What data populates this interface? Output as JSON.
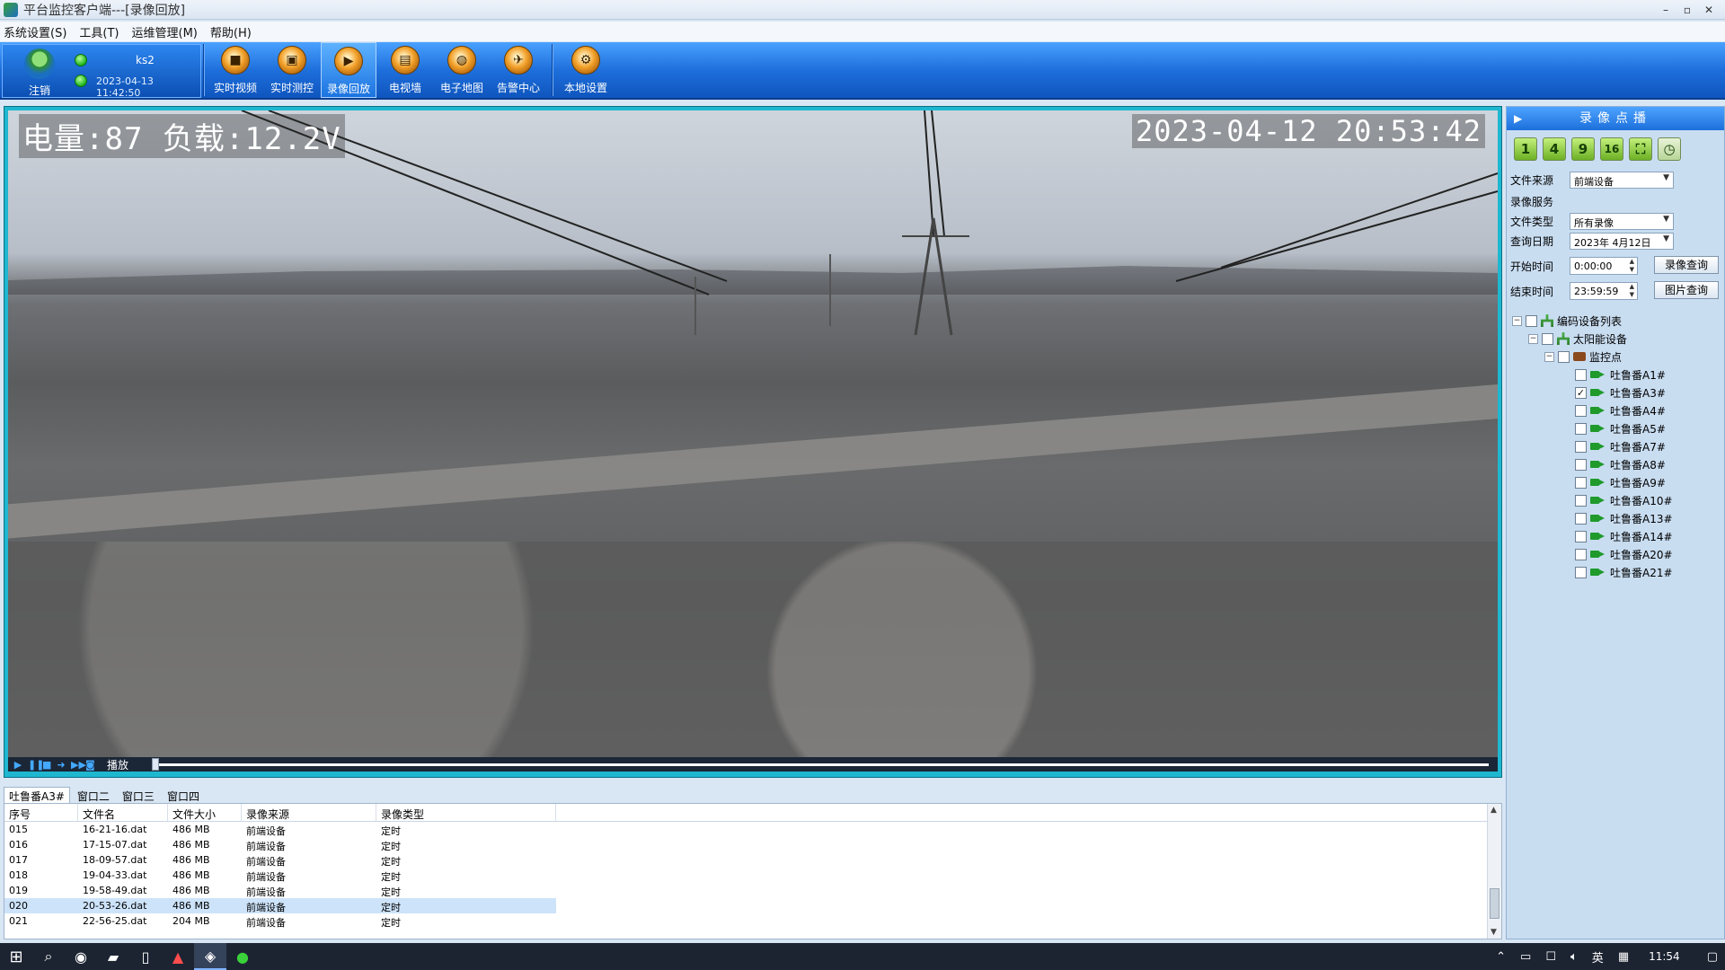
{
  "window": {
    "title": "平台监控客户端---[录像回放]",
    "controls": [
      "–",
      "▫",
      "✕"
    ]
  },
  "menu": [
    "系统设置(S)",
    "工具(T)",
    "运维管理(M)",
    "帮助(H)"
  ],
  "toolbar": {
    "logout_label": "注销",
    "username": "ks2",
    "datetime": "2023-04-13 11:42:50",
    "buttons": [
      {
        "label": "实时视频",
        "icon": "video-camera-icon",
        "active": false
      },
      {
        "label": "实时测控",
        "icon": "control-icon",
        "active": false
      },
      {
        "label": "录像回放",
        "icon": "playback-icon",
        "active": true
      },
      {
        "label": "电视墙",
        "icon": "tv-wall-icon",
        "active": false
      },
      {
        "label": "电子地图",
        "icon": "globe-map-icon",
        "active": false
      },
      {
        "label": "告警中心",
        "icon": "alarm-icon",
        "active": false
      },
      {
        "label": "本地设置",
        "icon": "gear-icon",
        "active": false
      }
    ]
  },
  "video": {
    "osd_left": "电量:87 负载:12.2V",
    "osd_right": "2023-04-12 20:53:42",
    "play_label": "播放",
    "playback_progress": 0.0
  },
  "tabs": [
    "吐鲁番A3#",
    "窗口二",
    "窗口三",
    "窗口四"
  ],
  "file_list": {
    "columns": [
      "序号",
      "文件名",
      "文件大小",
      "录像来源",
      "录像类型"
    ],
    "rows": [
      [
        "015",
        "16-21-16.dat",
        "486 MB",
        "前端设备",
        "定时"
      ],
      [
        "016",
        "17-15-07.dat",
        "486 MB",
        "前端设备",
        "定时"
      ],
      [
        "017",
        "18-09-57.dat",
        "486 MB",
        "前端设备",
        "定时"
      ],
      [
        "018",
        "19-04-33.dat",
        "486 MB",
        "前端设备",
        "定时"
      ],
      [
        "019",
        "19-58-49.dat",
        "486 MB",
        "前端设备",
        "定时"
      ],
      [
        "020",
        "20-53-26.dat",
        "486 MB",
        "前端设备",
        "定时"
      ],
      [
        "021",
        "22-56-25.dat",
        "204 MB",
        "前端设备",
        "定时"
      ]
    ],
    "selected_row": 5
  },
  "right_panel": {
    "title": "录像点播",
    "layout_buttons": [
      "1",
      "4",
      "9",
      "16",
      "⛶",
      "◷"
    ],
    "file_source_label": "文件来源",
    "file_source_value": "前端设备",
    "record_service_label": "录像服务",
    "file_type_label": "文件类型",
    "file_type_value": "所有录像",
    "query_date_label": "查询日期",
    "query_date_value": "2023年  4月12日",
    "start_time_label": "开始时间",
    "start_time_value": "0:00:00",
    "end_time_label": "结束时间",
    "end_time_value": "23:59:59",
    "record_query_button": "录像查询",
    "image_query_button": "图片查询",
    "tree": {
      "root": "编码设备列表",
      "group": "太阳能设备",
      "monitor": "监控点",
      "cameras": [
        {
          "name": "吐鲁番A1#",
          "checked": false
        },
        {
          "name": "吐鲁番A3#",
          "checked": true
        },
        {
          "name": "吐鲁番A4#",
          "checked": false
        },
        {
          "name": "吐鲁番A5#",
          "checked": false
        },
        {
          "name": "吐鲁番A7#",
          "checked": false
        },
        {
          "name": "吐鲁番A8#",
          "checked": false
        },
        {
          "name": "吐鲁番A9#",
          "checked": false
        },
        {
          "name": "吐鲁番A10#",
          "checked": false
        },
        {
          "name": "吐鲁番A13#",
          "checked": false
        },
        {
          "name": "吐鲁番A14#",
          "checked": false
        },
        {
          "name": "吐鲁番A20#",
          "checked": false
        },
        {
          "name": "吐鲁番A21#",
          "checked": false
        }
      ]
    }
  },
  "taskbar": {
    "apps": [
      "windows-start-icon",
      "search-icon",
      "chrome-icon",
      "file-explorer-icon",
      "notepad-icon",
      "pdf-icon",
      "monitor-client-icon",
      "wechat-icon"
    ],
    "ime": "英",
    "clock": "11:54"
  }
}
